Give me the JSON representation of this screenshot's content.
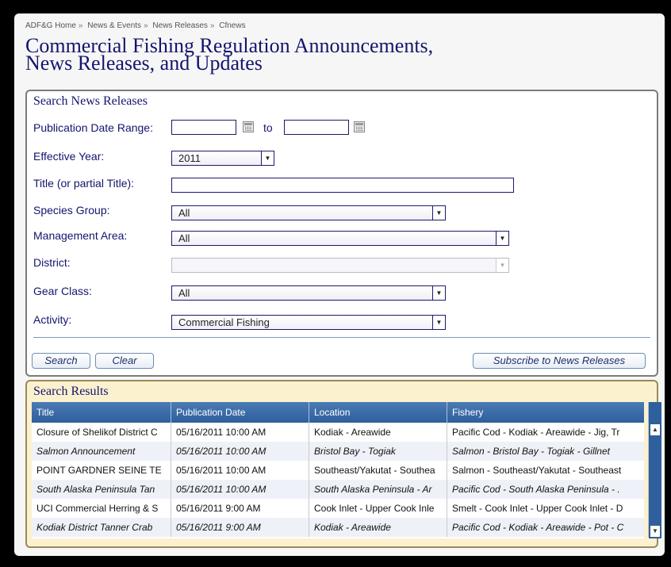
{
  "breadcrumb": [
    "ADF&G Home",
    "News & Events",
    "News Releases",
    "Cfnews"
  ],
  "page_title_line1": "Commercial Fishing Regulation Announcements,",
  "page_title_line2": "News Releases, and Updates",
  "search": {
    "title": "Search News Releases",
    "publication_date_label": "Publication Date Range:",
    "to_label": "to",
    "date_from": "",
    "date_to": "",
    "effective_year_label": "Effective Year:",
    "effective_year_value": "2011",
    "title_label": "Title (or partial Title):",
    "title_value": "",
    "species_label": "Species Group:",
    "species_value": "All",
    "management_label": "Management Area:",
    "management_value": "All",
    "district_label": "District:",
    "district_value": "",
    "gear_label": "Gear Class:",
    "gear_value": "All",
    "activity_label": "Activity:",
    "activity_value": "Commercial Fishing",
    "search_button": "Search",
    "clear_button": "Clear",
    "subscribe_button": "Subscribe to News Releases"
  },
  "results": {
    "title": "Search Results",
    "columns": [
      "Title",
      "Publication Date",
      "Location",
      "Fishery"
    ],
    "rows": [
      {
        "title": "Closure of Shelikof District C",
        "date": "05/16/2011 10:00 AM",
        "location": "Kodiak - Areawide",
        "fishery": "Pacific Cod - Kodiak - Areawide - Jig, Tr"
      },
      {
        "title": "Salmon Announcement",
        "date": "05/16/2011 10:00 AM",
        "location": "Bristol Bay - Togiak",
        "fishery": "Salmon - Bristol Bay - Togiak - Gillnet"
      },
      {
        "title": "POINT GARDNER SEINE TE",
        "date": "05/16/2011 10:00 AM",
        "location": "Southeast/Yakutat - Southea",
        "fishery": "Salmon - Southeast/Yakutat - Southeast"
      },
      {
        "title": "South Alaska Peninsula Tan",
        "date": "05/16/2011 10:00 AM",
        "location": "South Alaska Peninsula - Ar",
        "fishery": "Pacific Cod - South Alaska Peninsula - ."
      },
      {
        "title": "UCI Commercial Herring & S",
        "date": "05/16/2011 9:00 AM",
        "location": "Cook Inlet - Upper Cook Inle",
        "fishery": "Smelt - Cook Inlet - Upper Cook Inlet - D"
      },
      {
        "title": "Kodiak District Tanner Crab",
        "date": "05/16/2011 9:00 AM",
        "location": "Kodiak - Areawide",
        "fishery": "Pacific Cod - Kodiak - Areawide - Pot - C"
      }
    ]
  }
}
